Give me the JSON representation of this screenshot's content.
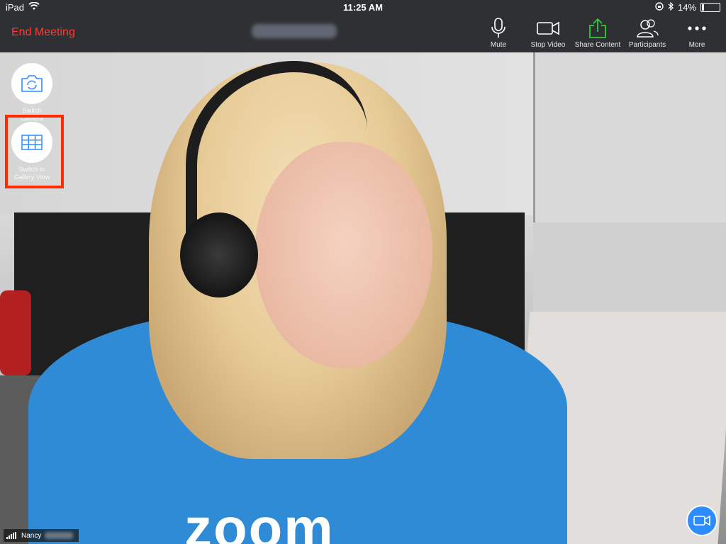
{
  "status_bar": {
    "device": "iPad",
    "time": "11:25 AM",
    "battery": "14%",
    "battery_level": 0.14
  },
  "header": {
    "end_meeting_label": "End Meeting"
  },
  "toolbar": [
    {
      "label": "Mute",
      "icon": "microphone-icon"
    },
    {
      "label": "Stop Video",
      "icon": "video-camera-icon"
    },
    {
      "label": "Share Content",
      "icon": "share-upload-icon"
    },
    {
      "label": "Participants",
      "icon": "participants-icon"
    },
    {
      "label": "More",
      "icon": "more-dots-icon"
    }
  ],
  "side_controls": {
    "switch_camera_label": "Switch Camera",
    "gallery_view_label": "Switch to Gallery View"
  },
  "participant": {
    "name": "Nancy"
  },
  "shirt_text": "zoom",
  "colors": {
    "end_meeting": "#ff3b30",
    "share_green": "#2ecc40",
    "accent_blue": "#2d8cff",
    "highlight_red": "#ff2a00"
  }
}
